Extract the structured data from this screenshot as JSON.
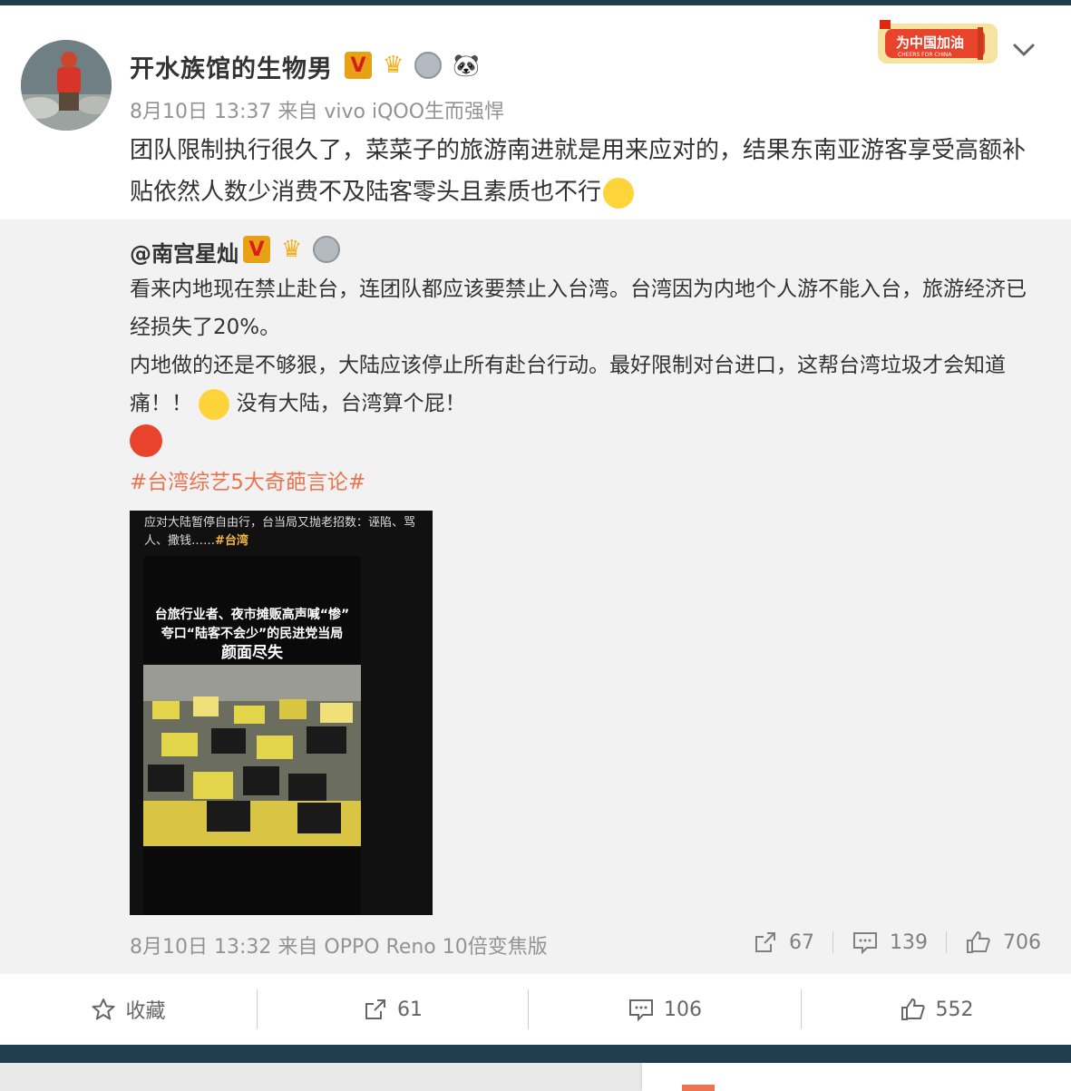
{
  "post": {
    "author": "开水族馆的生物男",
    "meta": "8月10日 13:37 来自 vivo iQOO生而强悍",
    "text": "团队限制执行很久了，菜菜子的旅游南进就是用来应对的，结果东南亚游客享受高额补贴依然人数少消费不及陆客零头且素质也不行",
    "badge_v": "V",
    "cheer_label": "为中国加油",
    "cheer_sub": "CHEERS FOR CHINA"
  },
  "quote": {
    "author": "@南宫星灿",
    "badge_v": "V",
    "line1": "看来内地现在禁止赴台，连团队都应该要禁止入台湾。台湾因为内地个人游不能入台，旅游经济已经损失了20%。",
    "line2a": "内地做的还是不够狠，大陆应该停止所有赴台行动。最好限制对台进口，这帮台湾垃圾才会知道痛！！",
    "line2b": "没有大陆，台湾算个屁！",
    "hashtag": "#台湾综艺5大奇葩言论#",
    "image": {
      "caption": "应对大陆暂停自由行，台当局又抛老招数：诬陷、骂人、撒钱……",
      "caption_tag": "#台湾",
      "headline1": "台旅行业者、夜市摊贩高声喊“惨”",
      "headline2": "夸口“陆客不会少”的民进党当局",
      "headline3": "颜面尽失"
    },
    "meta": "8月10日 13:32 来自 OPPO Reno 10倍变焦版",
    "reposts": "67",
    "comments": "139",
    "likes": "706"
  },
  "actions": {
    "favorite": "收藏",
    "reposts": "61",
    "comments": "106",
    "likes": "552"
  }
}
